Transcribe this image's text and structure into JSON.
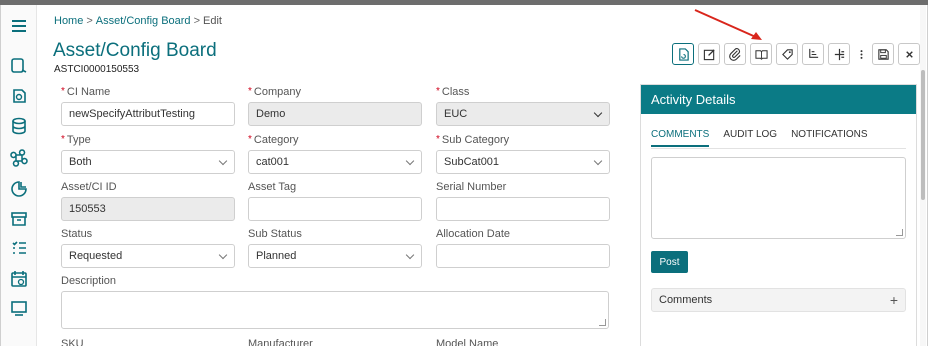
{
  "breadcrumb": {
    "home": "Home",
    "section": "Asset/Config Board",
    "current": "Edit",
    "sep": ">"
  },
  "page": {
    "title": "Asset/Config Board",
    "record_id": "ASTCI0000150553"
  },
  "sidebar": {
    "items": [
      {
        "icon": "menu-icon"
      },
      {
        "icon": "request-icon"
      },
      {
        "icon": "service-icon"
      },
      {
        "icon": "database-icon"
      },
      {
        "icon": "command-icon"
      },
      {
        "icon": "report-icon"
      },
      {
        "icon": "archive-icon"
      },
      {
        "icon": "list-icon"
      },
      {
        "icon": "calendar-icon"
      },
      {
        "icon": "monitor-icon"
      }
    ]
  },
  "toolbar": {
    "buttons": [
      "save-refresh-icon",
      "edit-icon",
      "attachment-icon",
      "book-icon",
      "tag-icon",
      "relations-icon",
      "hierarchy-icon",
      "more-icon",
      "save-icon",
      "close-icon"
    ]
  },
  "form": {
    "ci_name": {
      "label": "CI Name",
      "value": "newSpecifyAttributTesting",
      "required": "*"
    },
    "company": {
      "label": "Company",
      "value": "Demo",
      "required": "*"
    },
    "class": {
      "label": "Class",
      "value": "EUC",
      "required": "*"
    },
    "type": {
      "label": "Type",
      "value": "Both",
      "required": "*"
    },
    "category": {
      "label": "Category",
      "value": "cat001",
      "required": "*"
    },
    "sub_category": {
      "label": "Sub Category",
      "value": "SubCat001",
      "required": "*"
    },
    "asset_ci_id": {
      "label": "Asset/CI ID",
      "value": "150553"
    },
    "asset_tag": {
      "label": "Asset Tag",
      "value": ""
    },
    "serial_number": {
      "label": "Serial Number",
      "value": ""
    },
    "status": {
      "label": "Status",
      "value": "Requested"
    },
    "sub_status": {
      "label": "Sub Status",
      "value": "Planned"
    },
    "allocation_date": {
      "label": "Allocation Date",
      "value": ""
    },
    "description": {
      "label": "Description",
      "value": ""
    },
    "sku": {
      "label": "SKU"
    },
    "manufacturer": {
      "label": "Manufacturer"
    },
    "model_name": {
      "label": "Model Name"
    }
  },
  "activity": {
    "title": "Activity Details",
    "tabs": [
      "COMMENTS",
      "AUDIT LOG",
      "NOTIFICATIONS"
    ],
    "post_label": "Post",
    "comments_label": "Comments",
    "expand_symbol": "+"
  },
  "colors": {
    "accent": "#0b6f7c",
    "header": "#0b7b86",
    "required": "#d0021b",
    "annotation_arrow": "#d9261c"
  }
}
